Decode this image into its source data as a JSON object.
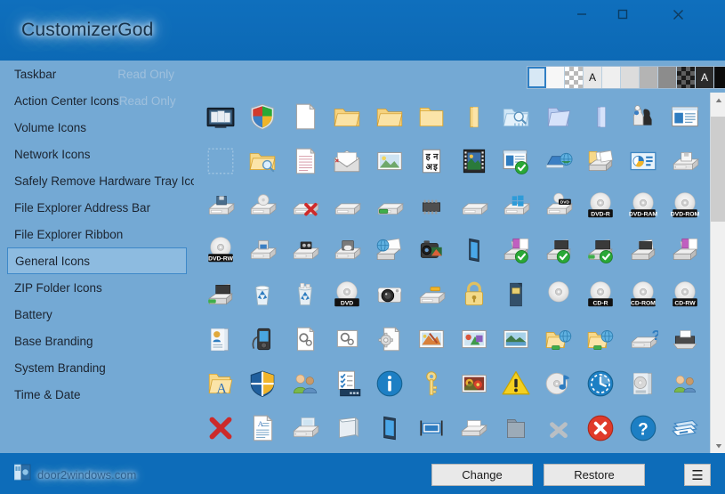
{
  "window": {
    "title": "CustomizerGod",
    "controls": [
      {
        "name": "minimize",
        "glyph": "minimize-icon"
      },
      {
        "name": "maximize",
        "glyph": "maximize-icon"
      },
      {
        "name": "close",
        "glyph": "close-icon"
      }
    ]
  },
  "colors": {
    "titlebar": "#0d6cb9",
    "panel": "#74a9d4",
    "selected_fill": "#8dbbe0",
    "selected_border": "#3d88c8",
    "readonly_text": "#9fc0dd",
    "button_face": "#e9e9e9"
  },
  "sidebar": {
    "items": [
      {
        "label": "Taskbar",
        "badge": "Read Only",
        "selected": false
      },
      {
        "label": "Action Center Icons",
        "badge": "Read Only",
        "selected": false
      },
      {
        "label": "Volume Icons",
        "badge": "",
        "selected": false
      },
      {
        "label": "Network Icons",
        "badge": "",
        "selected": false
      },
      {
        "label": "Safely Remove Hardware Tray Icon",
        "badge": "",
        "selected": false
      },
      {
        "label": "File Explorer Address Bar",
        "badge": "",
        "selected": false
      },
      {
        "label": "File Explorer Ribbon",
        "badge": "",
        "selected": false
      },
      {
        "label": "General Icons",
        "badge": "",
        "selected": true
      },
      {
        "label": "ZIP Folder Icons",
        "badge": "",
        "selected": false
      },
      {
        "label": "Battery",
        "badge": "",
        "selected": false
      },
      {
        "label": "Base Branding",
        "badge": "",
        "selected": false
      },
      {
        "label": "System Branding",
        "badge": "",
        "selected": false
      },
      {
        "label": "Time & Date",
        "badge": "",
        "selected": false
      }
    ]
  },
  "palette": {
    "swatches": [
      {
        "name": "light-blue-swatch",
        "color": "#d7e8f5",
        "label": "",
        "selected": true,
        "pattern": "solid"
      },
      {
        "name": "white-swatch",
        "color": "#f7f7f7",
        "label": "",
        "selected": false,
        "pattern": "solid"
      },
      {
        "name": "checker-swatch",
        "color": "",
        "label": "",
        "selected": false,
        "pattern": "checker"
      },
      {
        "name": "dark-text-swatch",
        "color": "#e8e8e8",
        "label": "A",
        "selected": false,
        "pattern": "solid"
      },
      {
        "name": "gray-95-swatch",
        "color": "#efefef",
        "label": "",
        "selected": false,
        "pattern": "solid"
      },
      {
        "name": "gray-85-swatch",
        "color": "#dcdcdc",
        "label": "",
        "selected": false,
        "pattern": "solid"
      },
      {
        "name": "gray-70-swatch",
        "color": "#b4b4b4",
        "label": "",
        "selected": false,
        "pattern": "solid"
      },
      {
        "name": "gray-50-swatch",
        "color": "#8c8c8c",
        "label": "",
        "selected": false,
        "pattern": "solid"
      },
      {
        "name": "checker-dark-swatch",
        "color": "",
        "label": "",
        "selected": false,
        "pattern": "checker-dark"
      },
      {
        "name": "light-text-swatch",
        "color": "#2b2b2b",
        "label": "A",
        "selected": false,
        "pattern": "solid"
      },
      {
        "name": "black-swatch",
        "color": "#0b0b0b",
        "label": "",
        "selected": false,
        "pattern": "solid"
      }
    ]
  },
  "grid": {
    "columns": 12,
    "rows": 8,
    "icons": [
      "presentation-screen-icon",
      "windows-shield-color-icon",
      "blank-document-icon",
      "folder-open-icon",
      "folder-open-icon",
      "folder-closed-icon",
      "folder-side-icon",
      "folder-search-icon",
      "folder-blue-open-icon",
      "folder-blue-side-icon",
      "chess-pieces-icon",
      "window-layout-icon",
      "empty-placeholder-icon",
      "folder-search-small-icon",
      "lined-document-icon",
      "open-envelope-icon",
      "picture-frame-icon",
      "font-characters-icon",
      "film-strip-icon",
      "window-check-icon",
      "network-computer-icon",
      "folder-print-icon",
      "chart-window-icon",
      "floppy-drive-icon",
      "drive-floppy-icon",
      "drive-disc-icon",
      "drive-error-icon",
      "drive-plain-icon",
      "drive-usb-icon",
      "memory-chip-icon",
      "drive-flat-icon",
      "drive-windows-icon",
      "drive-dvd-icon",
      "disc-dvd-r-icon",
      "disc-dvd-ram-icon",
      "disc-dvd-rom-icon",
      "disc-dvd-rw-icon",
      "drive-zip-icon",
      "drive-tape-icon",
      "drive-cartridge-icon",
      "scanner-web-icon",
      "camcorder-icon",
      "mobile-device-icon",
      "printer-floppy-check-icon",
      "printer-check-icon",
      "printer-usb-check-icon",
      "printer-small-icon",
      "printer-floppy-icon",
      "printer-usb-icon",
      "recycle-bin-empty-icon",
      "recycle-bin-full-icon",
      "disc-dvd-plain-icon",
      "camera-icon",
      "drive-key-icon",
      "padlock-icon",
      "memory-card-icon",
      "disc-blank-icon",
      "disc-cd-r-icon",
      "disc-cd-rom-icon",
      "disc-cd-rw-icon",
      "contact-card-icon",
      "media-player-icon",
      "settings-document-icon",
      "settings-page-icon",
      "gear-document-icon",
      "paint-picture-icon",
      "shapes-picture-icon",
      "landscape-picture-icon",
      "folder-network-share-icon",
      "folder-network-share-icon",
      "drive-unknown-icon",
      "printer-dark-icon",
      "folder-font-icon",
      "shield-gold-icon",
      "users-icon",
      "checklist-taskbar-icon",
      "info-circle-icon",
      "key-icon",
      "photo-flowers-icon",
      "warning-triangle-icon",
      "disc-music-icon",
      "clock-history-icon",
      "folder-disc-icon",
      "users-small-icon",
      "red-cross-icon",
      "text-document-icon",
      "drive-monitor-icon",
      "panel-3d-icon",
      "tablet-icon",
      "window-resize-icon",
      "scanner-flat-icon",
      "folder-dark-icon",
      "gray-x-icon",
      "error-circle-icon",
      "help-circle-icon",
      "window-cascade-icon"
    ]
  },
  "scrollbar": {
    "up_arrow": "scroll-up-icon",
    "down_arrow": "scroll-down-icon",
    "thumb_position_percent": 4
  },
  "bottom": {
    "brand_text": "door2windows.com",
    "brand_logo": "door2windows-logo-icon",
    "change_label": "Change",
    "restore_label": "Restore",
    "menu_label": "☰"
  }
}
